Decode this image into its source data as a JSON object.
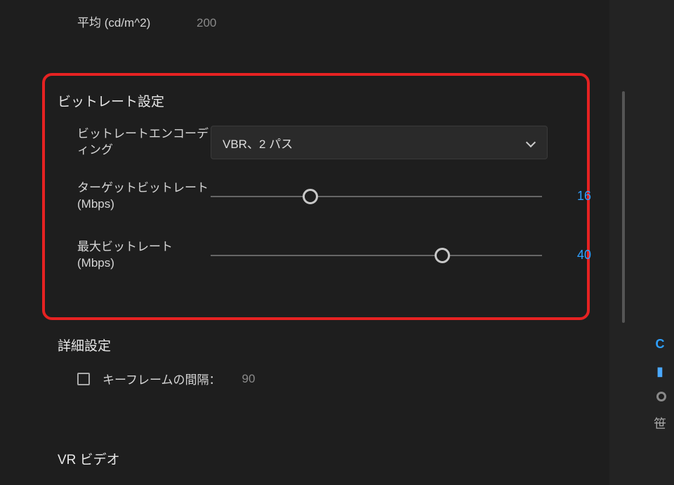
{
  "luminance": {
    "label": "平均 (cd/m^2)",
    "value": "200"
  },
  "bitrate": {
    "section_title": "ビットレート設定",
    "encoding": {
      "label": "ビットレートエンコーディング",
      "selected": "VBR、2 パス"
    },
    "target": {
      "label": "ターゲットビットレート (Mbps)",
      "value": "16",
      "thumb_pct": 30
    },
    "max": {
      "label": "最大ビットレート (Mbps)",
      "value": "40",
      "thumb_pct": 70
    }
  },
  "advanced": {
    "section_title": "詳細設定",
    "keyframe": {
      "checked": false,
      "label": "キーフレームの間隔：",
      "value": "90"
    }
  },
  "vr": {
    "section_title": "VR ビデオ"
  }
}
